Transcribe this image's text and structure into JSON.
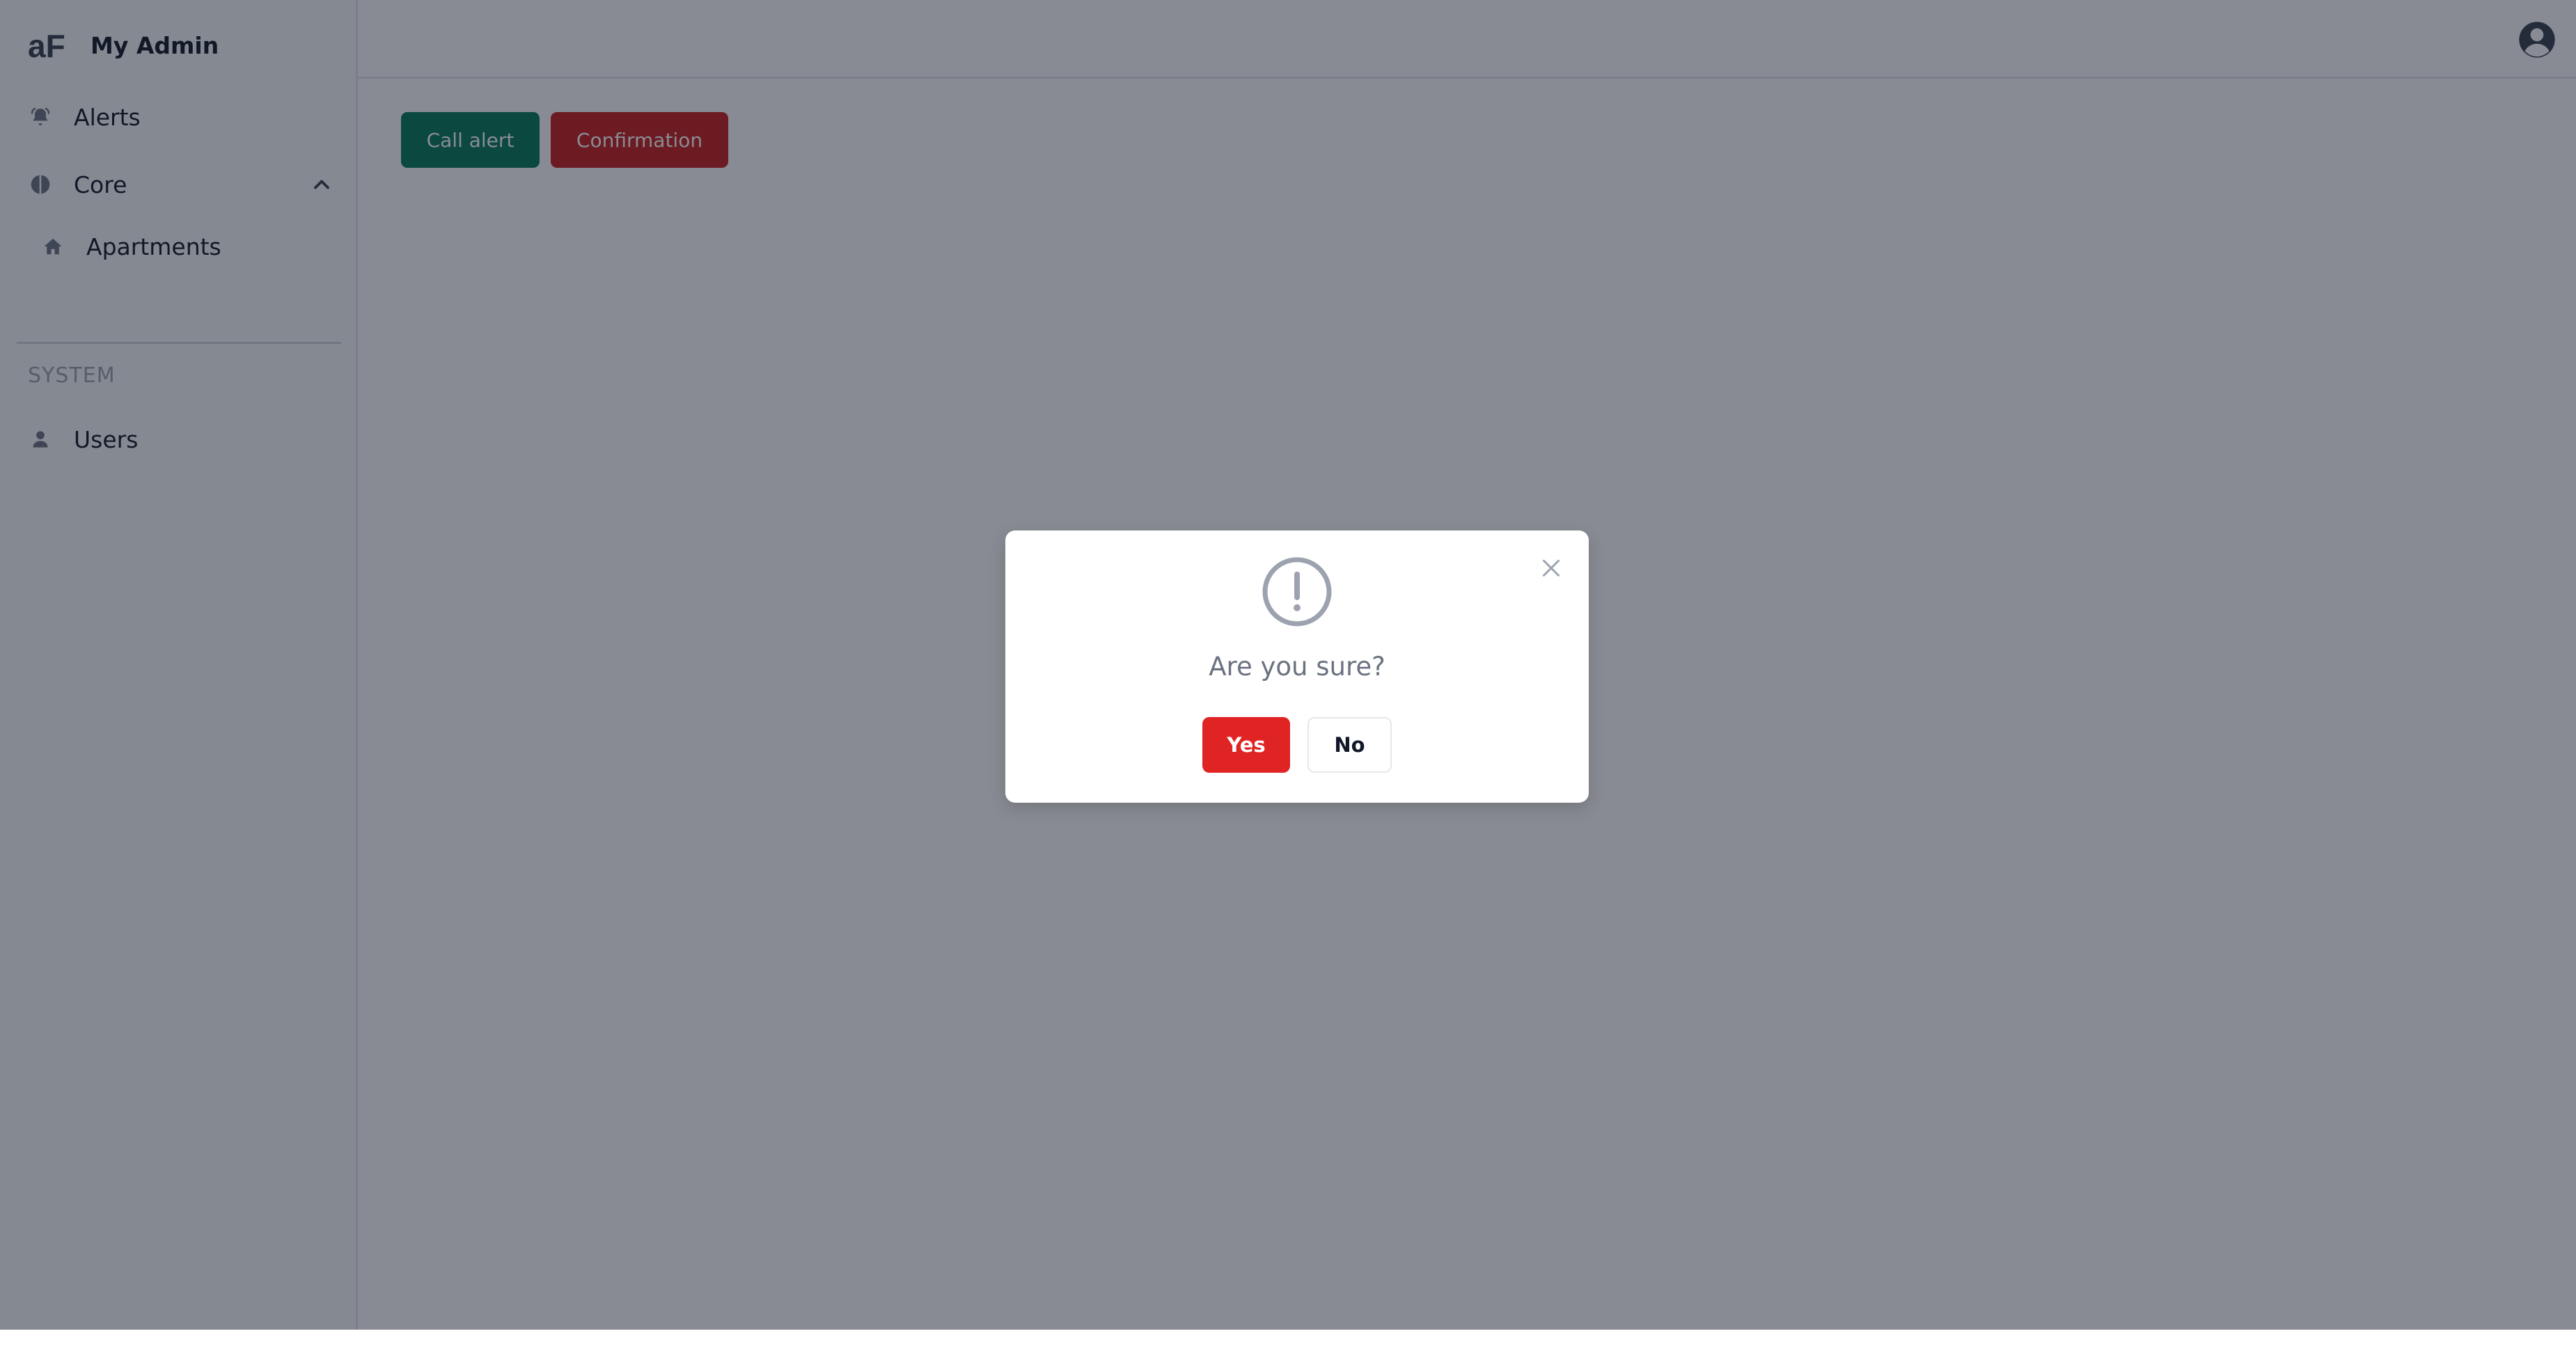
{
  "app": {
    "brand_title": "My Admin",
    "logo_text": "aF"
  },
  "sidebar": {
    "items": [
      {
        "label": "Alerts",
        "icon": "bell-ring-icon"
      },
      {
        "label": "Core",
        "icon": "layers-icon",
        "expanded": true
      },
      {
        "label": "Apartments",
        "icon": "home-icon"
      }
    ],
    "section_title": "SYSTEM",
    "system_items": [
      {
        "label": "Users",
        "icon": "user-icon"
      }
    ]
  },
  "topbar": {
    "avatar_icon": "user-circle-icon"
  },
  "content": {
    "call_alert_label": "Call alert",
    "confirmation_label": "Confirmation"
  },
  "modal": {
    "message": "Are you sure?",
    "yes_label": "Yes",
    "no_label": "No",
    "icon": "exclamation-circle-icon"
  },
  "colors": {
    "call_alert_bg": "#047857",
    "confirmation_bg": "#c81e1e",
    "yes_bg": "#e02424",
    "overlay": "rgba(17,24,39,0.5)"
  }
}
